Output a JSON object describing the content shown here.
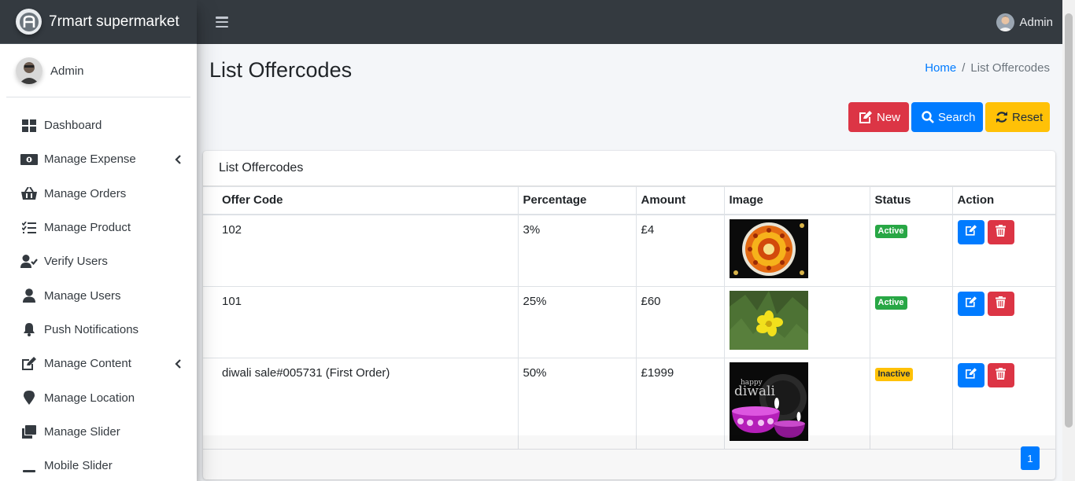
{
  "brand": {
    "name": "7rmart supermarket"
  },
  "sidebar": {
    "user_name": "Admin",
    "items": [
      {
        "label": "Dashboard",
        "icon": "dashboard-icon",
        "has_submenu": false
      },
      {
        "label": "Manage Expense",
        "icon": "money-bill-icon",
        "has_submenu": true
      },
      {
        "label": "Manage Orders",
        "icon": "basket-icon",
        "has_submenu": false
      },
      {
        "label": "Manage Product",
        "icon": "tasks-icon",
        "has_submenu": false
      },
      {
        "label": "Verify Users",
        "icon": "user-check-icon",
        "has_submenu": false
      },
      {
        "label": "Manage Users",
        "icon": "user-icon",
        "has_submenu": false
      },
      {
        "label": "Push Notifications",
        "icon": "bell-icon",
        "has_submenu": false
      },
      {
        "label": "Manage Content",
        "icon": "edit-icon",
        "has_submenu": true
      },
      {
        "label": "Manage Location",
        "icon": "map-marker-icon",
        "has_submenu": false
      },
      {
        "label": "Manage Slider",
        "icon": "clone-icon",
        "has_submenu": false
      },
      {
        "label": "Mobile Slider",
        "icon": "minus-icon",
        "has_submenu": false
      }
    ]
  },
  "topbar": {
    "user_name": "Admin"
  },
  "header": {
    "title": "List Offercodes",
    "breadcrumb_home": "Home",
    "breadcrumb_current": "List Offercodes"
  },
  "actions": {
    "new_label": "New",
    "search_label": "Search",
    "reset_label": "Reset"
  },
  "card": {
    "title": "List Offercodes",
    "columns": [
      "Offer Code",
      "Percentage",
      "Amount",
      "Image",
      "Status",
      "Action"
    ],
    "rows": [
      {
        "code": "102",
        "percentage": "3%",
        "amount": "£4",
        "image": "rangoli",
        "status": "Active"
      },
      {
        "code": "101",
        "percentage": "25%",
        "amount": "£60",
        "image": "yellow-flower",
        "status": "Active"
      },
      {
        "code": "diwali sale#005731 (First Order)",
        "percentage": "50%",
        "amount": "£1999",
        "image": "happy-diwali",
        "status": "Inactive",
        "image_text_1": "happy",
        "image_text_2": "diwali"
      }
    ],
    "pagination": {
      "current": "1"
    }
  },
  "colors": {
    "primary": "#007bff",
    "danger": "#dc3545",
    "warning": "#ffc107",
    "success": "#28a745",
    "dark": "#343a40"
  }
}
